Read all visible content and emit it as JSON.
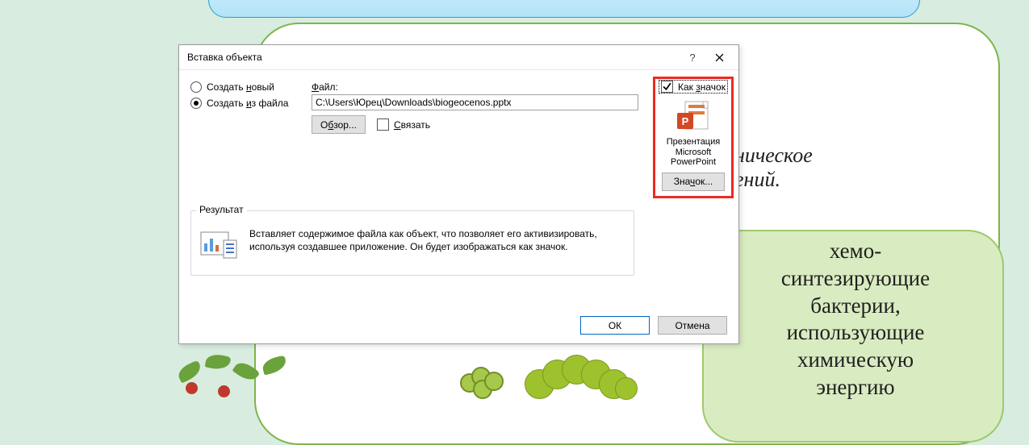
{
  "bg": {
    "organic_text": "ническое\nений.",
    "bacteria_text": "хемо-\nсинтезирующие\nбактерии,\nиспользующие\nхимическую\nэнергию"
  },
  "dialog": {
    "title": "Вставка объекта",
    "help": "?",
    "radios": {
      "create_new_pre": "Создать ",
      "create_new_u": "н",
      "create_new_post": "овый",
      "from_file_pre": "Создать ",
      "from_file_u": "и",
      "from_file_post": "з файла"
    },
    "file": {
      "label_u": "Ф",
      "label_post": "айл:",
      "path": "C:\\Users\\Юрец\\Downloads\\biogeocenos.pptx",
      "browse_pre": "О",
      "browse_u": "б",
      "browse_post": "зор...",
      "link_u": "С",
      "link_post": "вязать"
    },
    "result": {
      "legend": "Результат",
      "text": "Вставляет содержимое файла как объект, что позволяет его активизировать, используя создавшее приложение. Он будет изображаться как значок."
    },
    "icon_panel": {
      "chk_pre": "Как ",
      "chk_u": "з",
      "chk_post": "начок",
      "caption": "Презентация Microsoft PowerPoint",
      "change_pre": "Зна",
      "change_u": "ч",
      "change_post": "ок..."
    },
    "ok": "ОК",
    "cancel": "Отмена"
  }
}
